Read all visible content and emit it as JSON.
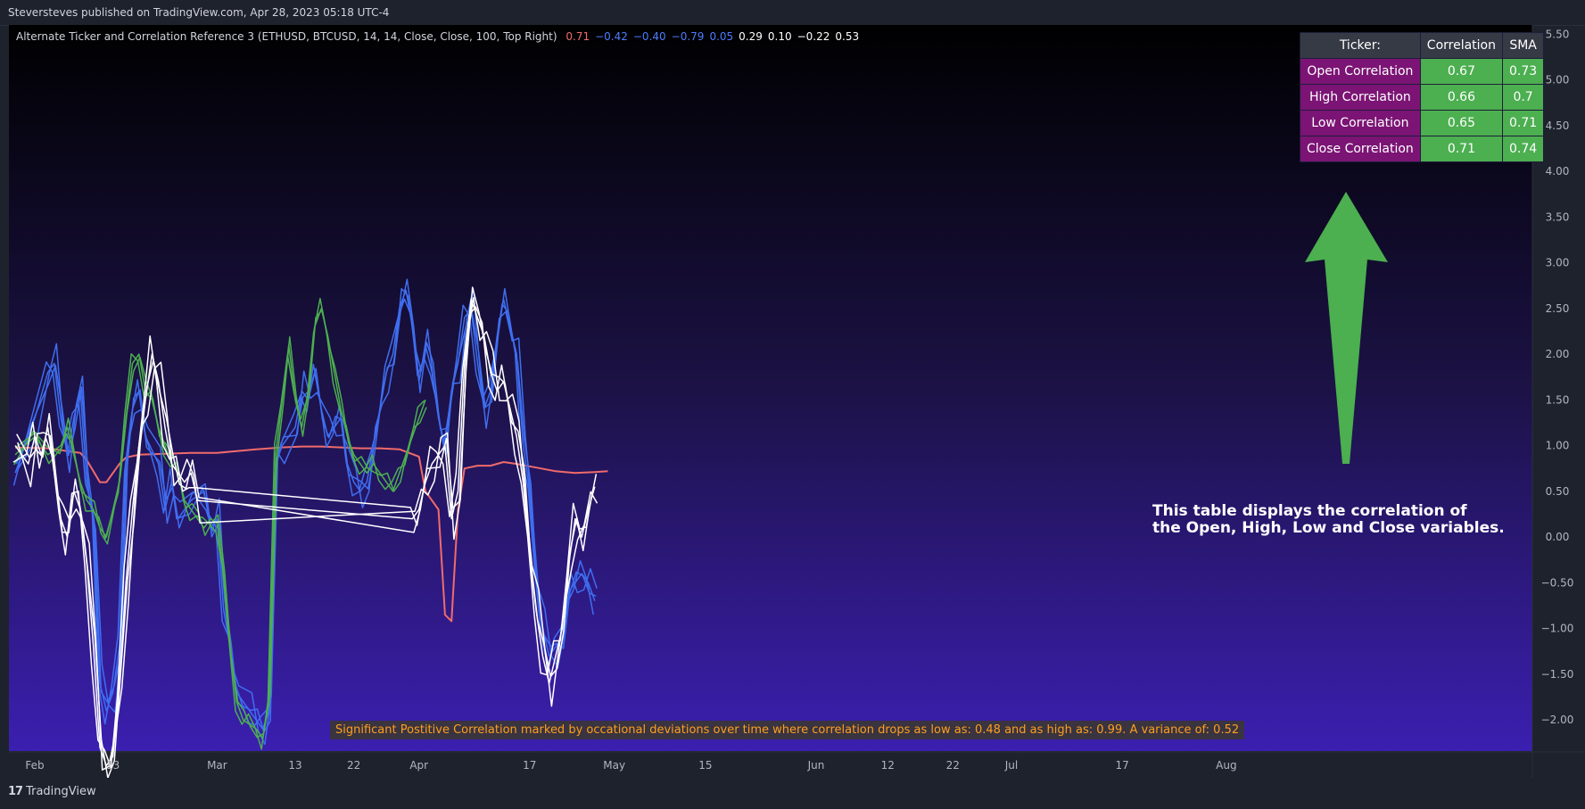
{
  "header": {
    "published": "Steversteves published on TradingView.com, Apr 28, 2023 05:18 UTC-4"
  },
  "footer": {
    "brand": "TradingView",
    "brand_mark": "17"
  },
  "indicator": {
    "title": "Alternate Ticker and Correlation Reference 3 (ETHUSD, BTCUSD, 14, 14, Close, Close, 100, Top Right)",
    "values": [
      {
        "text": "0.71",
        "color": "#f06b6b"
      },
      {
        "text": "−0.42",
        "color": "#4d7cff"
      },
      {
        "text": "−0.40",
        "color": "#4d7cff"
      },
      {
        "text": "−0.79",
        "color": "#4d7cff"
      },
      {
        "text": "0.05",
        "color": "#4d7cff"
      },
      {
        "text": "0.29",
        "color": "#ffffff"
      },
      {
        "text": "0.10",
        "color": "#ffffff"
      },
      {
        "text": "−0.22",
        "color": "#ffffff"
      },
      {
        "text": "0.53",
        "color": "#ffffff"
      }
    ]
  },
  "table": {
    "headers": [
      "Ticker:",
      "Correlation",
      "SMA"
    ],
    "rows": [
      {
        "label": "Open Correlation",
        "corr": "0.67",
        "sma": "0.73"
      },
      {
        "label": "High Correlation",
        "corr": "0.66",
        "sma": "0.7"
      },
      {
        "label": "Low Correlation",
        "corr": "0.65",
        "sma": "0.71"
      },
      {
        "label": "Close Correlation",
        "corr": "0.71",
        "sma": "0.74"
      }
    ]
  },
  "annotation": {
    "line1": "This table displays the correlation of",
    "line2": "the Open, High, Low and Close variables."
  },
  "bottom_note": "Significant Postitive Correlation marked by occational deviations over time where correlation drops as low as: 0.48 and as high as: 0.99. A variance of: 0.52",
  "colors": {
    "sma": "#f06b6b",
    "blue": "#3f6ef0",
    "green": "#4caf50",
    "white": "#ffffff",
    "arrow": "#4caf50"
  },
  "chart_data": {
    "type": "line",
    "ylim": [
      -2.35,
      5.6
    ],
    "y_ticks": [
      "5.50",
      "5.00",
      "4.50",
      "4.00",
      "3.50",
      "3.00",
      "2.50",
      "2.00",
      "1.50",
      "1.00",
      "0.50",
      "0.00",
      "−0.50",
      "−1.00",
      "−1.50",
      "−2.00"
    ],
    "x_ticks": [
      "Feb",
      "13",
      "Mar",
      "13",
      "22",
      "Apr",
      "17",
      "May",
      "15",
      "Jun",
      "12",
      "22",
      "Jul",
      "17",
      "Aug"
    ],
    "x_tick_days": [
      0,
      12,
      28,
      40,
      49,
      59,
      76,
      89,
      103,
      120,
      131,
      141,
      150,
      167,
      183
    ],
    "series": [
      {
        "color_key": "sma",
        "values": [
          [
            -3,
            0.98
          ],
          [
            2,
            0.97
          ],
          [
            5,
            0.94
          ],
          [
            7,
            0.92
          ],
          [
            8,
            0.84
          ],
          [
            9,
            0.72
          ],
          [
            10,
            0.6
          ],
          [
            11,
            0.6
          ],
          [
            13,
            0.8
          ],
          [
            14,
            0.87
          ],
          [
            16,
            0.9
          ],
          [
            20,
            0.91
          ],
          [
            24,
            0.92
          ],
          [
            28,
            0.92
          ],
          [
            31,
            0.94
          ],
          [
            34,
            0.96
          ],
          [
            38,
            0.98
          ],
          [
            41,
            0.99
          ],
          [
            44,
            0.99
          ],
          [
            47,
            0.98
          ],
          [
            50,
            0.97
          ],
          [
            53,
            0.97
          ],
          [
            56,
            0.96
          ],
          [
            59,
            0.88
          ],
          [
            60,
            0.5
          ],
          [
            61,
            0.4
          ],
          [
            62,
            0.3
          ],
          [
            63,
            -0.85
          ],
          [
            64,
            -0.92
          ],
          [
            65,
            0.3
          ],
          [
            66,
            0.75
          ],
          [
            68,
            0.78
          ],
          [
            70,
            0.78
          ],
          [
            72,
            0.82
          ],
          [
            74,
            0.8
          ],
          [
            77,
            0.76
          ],
          [
            80,
            0.72
          ],
          [
            83,
            0.7
          ],
          [
            86,
            0.71
          ],
          [
            88,
            0.72
          ]
        ]
      },
      {
        "color_key": "blue",
        "values": [
          [
            -3,
            0.7
          ],
          [
            0,
            1.3
          ],
          [
            2,
            1.8
          ],
          [
            3,
            1.9
          ],
          [
            4,
            1.3
          ],
          [
            5,
            0.9
          ],
          [
            6,
            1.3
          ],
          [
            7,
            1.6
          ],
          [
            8,
            0.6
          ],
          [
            9,
            0.2
          ],
          [
            10,
            -1.6
          ],
          [
            11,
            -1.9
          ],
          [
            12,
            -1.7
          ],
          [
            13,
            -1.2
          ],
          [
            14,
            0.8
          ],
          [
            15,
            1.4
          ],
          [
            16,
            1.6
          ],
          [
            17,
            1.1
          ],
          [
            19,
            0.8
          ],
          [
            20,
            0.3
          ],
          [
            21,
            0.6
          ],
          [
            22,
            0.2
          ],
          [
            24,
            0.4
          ],
          [
            26,
            0.5
          ],
          [
            27,
            0.1
          ],
          [
            28,
            0.2
          ],
          [
            29,
            -0.8
          ],
          [
            30,
            -1.2
          ],
          [
            31,
            -1.7
          ],
          [
            33,
            -1.9
          ],
          [
            34,
            -2.0
          ],
          [
            35,
            -2.1
          ],
          [
            36,
            -1.9
          ],
          [
            37,
            0.8
          ],
          [
            38,
            1.0
          ],
          [
            40,
            1.2
          ],
          [
            41,
            1.6
          ],
          [
            42,
            1.5
          ],
          [
            43,
            1.8
          ],
          [
            44,
            1.4
          ],
          [
            45,
            1.1
          ],
          [
            46,
            1.2
          ],
          [
            47,
            1.3
          ],
          [
            48,
            0.8
          ],
          [
            49,
            0.6
          ],
          [
            50,
            0.5
          ],
          [
            51,
            0.6
          ],
          [
            52,
            1.0
          ],
          [
            53,
            1.4
          ],
          [
            54,
            1.8
          ],
          [
            55,
            2.0
          ],
          [
            56,
            2.5
          ],
          [
            57,
            2.7
          ],
          [
            58,
            2.3
          ],
          [
            59,
            1.7
          ],
          [
            60,
            2.1
          ],
          [
            61,
            1.8
          ],
          [
            62,
            1.3
          ],
          [
            63,
            1.0
          ],
          [
            64,
            1.6
          ],
          [
            65,
            1.9
          ],
          [
            66,
            2.4
          ],
          [
            67,
            2.5
          ],
          [
            68,
            1.9
          ],
          [
            69,
            1.4
          ],
          [
            70,
            1.6
          ],
          [
            71,
            2.2
          ],
          [
            72,
            2.6
          ],
          [
            73,
            2.3
          ],
          [
            74,
            2.0
          ],
          [
            75,
            1.0
          ],
          [
            76,
            0.5
          ],
          [
            77,
            -0.5
          ],
          [
            78,
            -1.0
          ],
          [
            79,
            -1.3
          ],
          [
            80,
            -1.2
          ],
          [
            81,
            -1.1
          ],
          [
            82,
            -0.6
          ],
          [
            83,
            -0.5
          ],
          [
            84,
            -0.4
          ],
          [
            85,
            -0.5
          ],
          [
            86,
            -0.7
          ]
        ]
      },
      {
        "color_key": "green",
        "values": [
          [
            -3,
            0.9
          ],
          [
            0,
            1.1
          ],
          [
            2,
            0.9
          ],
          [
            4,
            1.0
          ],
          [
            5,
            1.2
          ],
          [
            6,
            0.9
          ],
          [
            7,
            0.6
          ],
          [
            8,
            0.4
          ],
          [
            9,
            0.3
          ],
          [
            10,
            0.1
          ],
          [
            11,
            0.0
          ],
          [
            13,
            0.6
          ],
          [
            14,
            1.3
          ],
          [
            15,
            1.9
          ],
          [
            16,
            2.0
          ],
          [
            17,
            1.6
          ],
          [
            18,
            1.5
          ],
          [
            19,
            1.2
          ],
          [
            20,
            1.0
          ],
          [
            21,
            0.8
          ],
          [
            22,
            0.7
          ],
          [
            23,
            0.4
          ],
          [
            24,
            0.3
          ],
          [
            25,
            0.2
          ],
          [
            26,
            0.1
          ],
          [
            27,
            0.2
          ],
          [
            28,
            0.15
          ],
          [
            29,
            -0.4
          ],
          [
            30,
            -1.2
          ],
          [
            31,
            -1.8
          ],
          [
            32,
            -2.0
          ],
          [
            33,
            -2.05
          ],
          [
            34,
            -2.1
          ],
          [
            35,
            -2.2
          ],
          [
            36,
            -1.8
          ],
          [
            37,
            0.9
          ],
          [
            38,
            1.5
          ],
          [
            39,
            2.1
          ],
          [
            40,
            1.5
          ],
          [
            41,
            1.2
          ],
          [
            42,
            1.6
          ],
          [
            43,
            2.3
          ],
          [
            44,
            2.5
          ],
          [
            45,
            2.2
          ],
          [
            46,
            1.8
          ],
          [
            47,
            1.4
          ],
          [
            48,
            1.1
          ],
          [
            49,
            0.9
          ],
          [
            50,
            0.8
          ],
          [
            51,
            0.7
          ],
          [
            52,
            0.8
          ],
          [
            53,
            0.7
          ],
          [
            54,
            0.6
          ],
          [
            55,
            0.5
          ],
          [
            56,
            0.7
          ],
          [
            57,
            0.9
          ],
          [
            58,
            1.1
          ],
          [
            59,
            1.3
          ],
          [
            60,
            1.5
          ]
        ]
      },
      {
        "color_key": "white",
        "values": [
          [
            -3,
            1.0
          ],
          [
            -1,
            0.8
          ],
          [
            0,
            1.1
          ],
          [
            1,
            0.9
          ],
          [
            2,
            1.2
          ],
          [
            3,
            0.7
          ],
          [
            4,
            0.2
          ],
          [
            5,
            0.0
          ],
          [
            6,
            0.5
          ],
          [
            7,
            0.3
          ],
          [
            8,
            -0.3
          ],
          [
            9,
            -1.2
          ],
          [
            10,
            -2.3
          ],
          [
            11,
            -2.5
          ],
          [
            12,
            -2.4
          ],
          [
            13,
            -1.6
          ],
          [
            14,
            -0.5
          ],
          [
            15,
            0.3
          ],
          [
            16,
            1.0
          ],
          [
            17,
            1.5
          ],
          [
            18,
            2.0
          ],
          [
            19,
            1.7
          ],
          [
            20,
            1.2
          ],
          [
            21,
            0.8
          ],
          [
            22,
            0.7
          ],
          [
            23,
            0.6
          ],
          [
            24,
            0.7
          ],
          [
            25,
            0.4
          ],
          [
            58,
            0.2
          ],
          [
            59,
            0.3
          ],
          [
            60,
            0.6
          ],
          [
            61,
            0.8
          ],
          [
            62,
            0.9
          ],
          [
            63,
            1.0
          ],
          [
            64,
            0.2
          ],
          [
            65,
            0.5
          ],
          [
            66,
            1.9
          ],
          [
            67,
            2.6
          ],
          [
            68,
            2.4
          ],
          [
            69,
            2.2
          ],
          [
            70,
            1.8
          ],
          [
            71,
            1.6
          ],
          [
            72,
            1.7
          ],
          [
            73,
            1.4
          ],
          [
            74,
            1.1
          ],
          [
            75,
            0.6
          ],
          [
            76,
            -0.2
          ],
          [
            77,
            -0.8
          ],
          [
            78,
            -1.3
          ],
          [
            79,
            -1.6
          ],
          [
            80,
            -1.3
          ],
          [
            81,
            -1.0
          ],
          [
            82,
            -0.3
          ],
          [
            83,
            0.2
          ],
          [
            84,
            0.0
          ],
          [
            85,
            0.3
          ],
          [
            86,
            0.55
          ]
        ]
      }
    ]
  }
}
